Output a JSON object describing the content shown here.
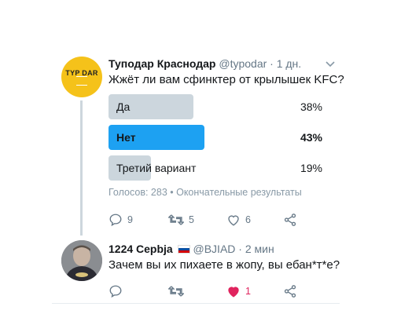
{
  "tweet1": {
    "author_name": "Туподар Краснодар",
    "handle_time": "@typodar · 1 дн.",
    "avatar_text": "TYP    DAR",
    "text": "Жжёт ли вам сфинктер от крылышек KFC?",
    "poll": {
      "options": [
        {
          "label": "Да",
          "percent": "38%",
          "share": 38,
          "winner": false
        },
        {
          "label": "Нет",
          "percent": "43%",
          "share": 43,
          "winner": true
        },
        {
          "label": "Третий вариант",
          "percent": "19%",
          "share": 19,
          "winner": false
        }
      ],
      "summary": "Голосов: 283 • Окончательные результаты"
    },
    "actions": {
      "replies": "9",
      "retweets": "5",
      "likes": "6"
    }
  },
  "tweet2": {
    "author_name": "1224 Cepbja",
    "handle_time": "@BJIAD · 2 мин",
    "text": "Зачем вы их пихаете в жопу, вы ебан*т*е?",
    "actions": {
      "likes": "1"
    }
  },
  "colors": {
    "accent": "#1da1f2",
    "bar": "#ccd6dd",
    "like": "#e0245e",
    "avatar": "#f5c21a"
  },
  "icons": [
    "reply-icon",
    "retweet-icon",
    "like-icon",
    "share-icon",
    "caret-down-icon",
    "flag-slovenia-icon"
  ]
}
